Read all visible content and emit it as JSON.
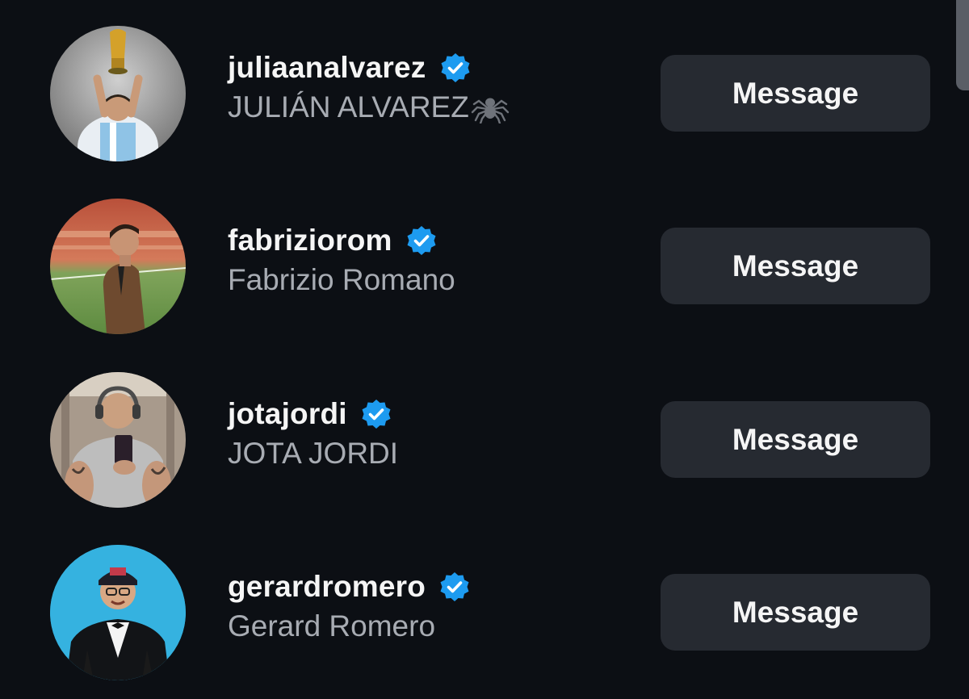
{
  "accounts": [
    {
      "username": "juliaanalvarez",
      "full_name": "JULIÁN ALVAREZ",
      "verified": true,
      "trailing_icon": "spider-icon",
      "button_label": "Message",
      "avatar": "avatar-trophy-photo"
    },
    {
      "username": "fabriziorom",
      "full_name": "Fabrizio Romano",
      "verified": true,
      "button_label": "Message",
      "avatar": "avatar-stadium-photo"
    },
    {
      "username": "jotajordi",
      "full_name": "JOTA JORDI",
      "verified": true,
      "button_label": "Message",
      "avatar": "avatar-gym-selfie-photo"
    },
    {
      "username": "gerardromero",
      "full_name": "Gerard Romero",
      "verified": true,
      "button_label": "Message",
      "avatar": "avatar-tuxedo-photo"
    }
  ],
  "colors": {
    "background": "#0c0f14",
    "verified_blue": "#1d9bf0",
    "button_bg": "#262a31",
    "secondary_text": "#a8acb3"
  }
}
